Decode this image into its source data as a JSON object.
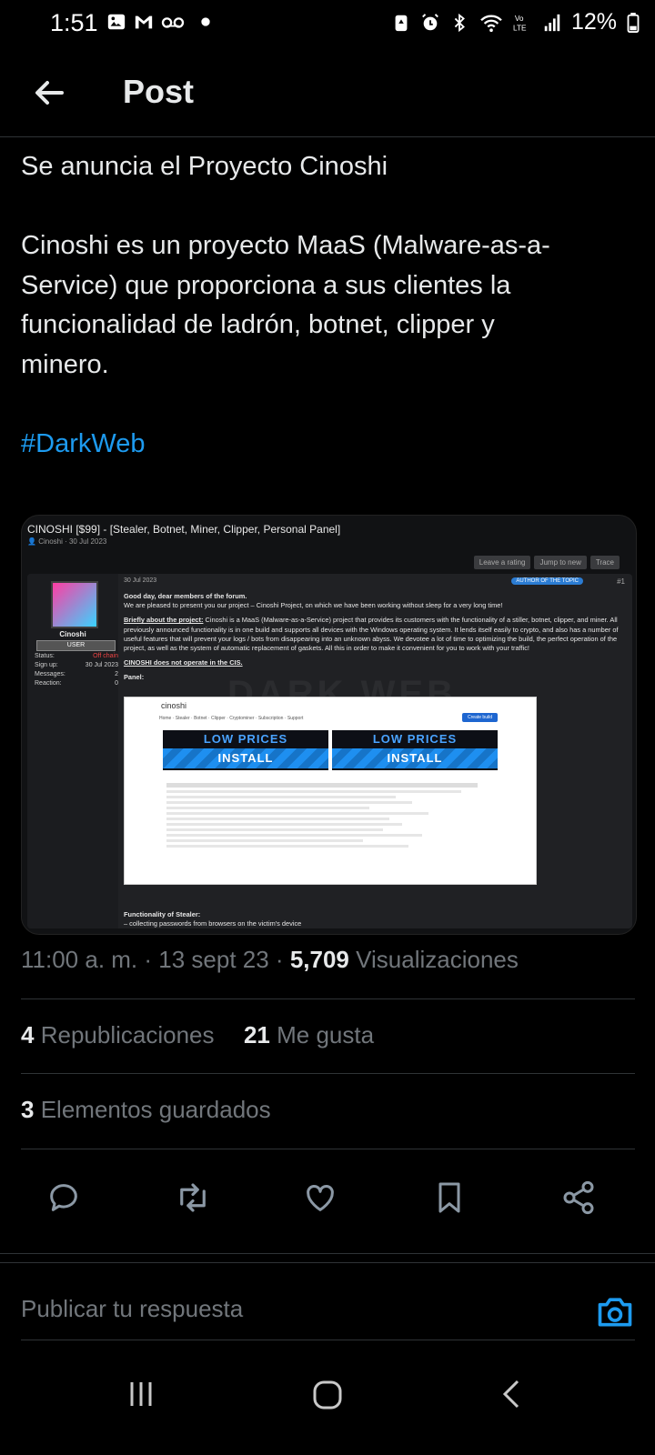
{
  "status_bar": {
    "time": "1:51",
    "battery": "12%",
    "icons_left": [
      "image-icon",
      "gmail-icon",
      "voicemail-icon",
      "dot-icon"
    ],
    "icons_right": [
      "battery-saver-icon",
      "alarm-icon",
      "bluetooth-icon",
      "wifi-icon",
      "volte-icon",
      "signal-icon",
      "battery-icon"
    ]
  },
  "header": {
    "title": "Post",
    "back_icon": "back-arrow-icon"
  },
  "post": {
    "line1": "Se anuncia el Proyecto Cinoshi",
    "body": "Cinoshi es un proyecto MaaS (Malware-as-a-Service) que proporciona a sus clientes la funcionalidad de ladrón, botnet, clipper y minero.",
    "hashtag": "#DarkWeb"
  },
  "media": {
    "forum_title": "CINOSHI [$99] - [Stealer, Botnet, Miner, Clipper, Personal Panel]",
    "forum_meta": "Cinoshi · 30 Jul 2023",
    "actions": [
      "Leave a rating",
      "Jump to new",
      "Trace"
    ],
    "user": {
      "name": "Cinoshi",
      "badge": "USER",
      "stats": [
        {
          "label": "Status:",
          "value": "Off chain"
        },
        {
          "label": "Sign up:",
          "value": "30 Jul 2023"
        },
        {
          "label": "Messages:",
          "value": "2"
        },
        {
          "label": "Reaction:",
          "value": "0"
        }
      ]
    },
    "post_date": "30 Jul 2023",
    "author_tag": "AUTHOR OF THE TOPIC",
    "post_number": "#1",
    "greeting": "Good day, dear members of the forum.",
    "intro": "We are pleased to present you our project – Cinoshi Project, on which we have been working without sleep for a very long time!",
    "brief_label": "Briefly about the project:",
    "brief_text": " Cinoshi is a MaaS (Malware-as-a-Service) project that provides its customers with the functionality of a stiller, botnet, clipper, and miner. All previously announced functionality is in one build and supports all devices with the Windows operating system. It lends itself easily to crypto, and also has a number of useful features that will prevent your logs / bots from disappearing into an unknown abyss. We devotee a lot of time to optimizing the build, the perfect operation of the project, as well as the system of automatic replacement of gaskets. All this in order to make it convenient for you to work with your traffic!",
    "cis": "CINOSHI does not operate in the CIS.",
    "panel_label": "Panel:",
    "panel": {
      "logo": "cinoshi",
      "nav": "Home · Stealer · Botnet · Clipper · Cryptominer · Subscription · Support",
      "button": "Create build",
      "banner_top": "LOW PRICES",
      "banner_bottom": "INSTALL"
    },
    "functionality": "Functionality of Stealer:",
    "functionality_item": "– collecting passwords from browsers on the victim's device",
    "watermark": "DARK WEB"
  },
  "meta": {
    "time": "11:00 a. m.",
    "date": "13 sept 23",
    "views_count": "5,709",
    "views_label": "Visualizaciones"
  },
  "stats": {
    "reposts_count": "4",
    "reposts_label": "Republicaciones",
    "likes_count": "21",
    "likes_label": "Me gusta",
    "bookmarks_count": "3",
    "bookmarks_label": "Elementos guardados"
  },
  "reply": {
    "placeholder": "Publicar tu respuesta"
  },
  "colors": {
    "accent": "#1d9bf0",
    "background": "#000000",
    "muted": "#71767b",
    "divider": "#2f3336"
  }
}
